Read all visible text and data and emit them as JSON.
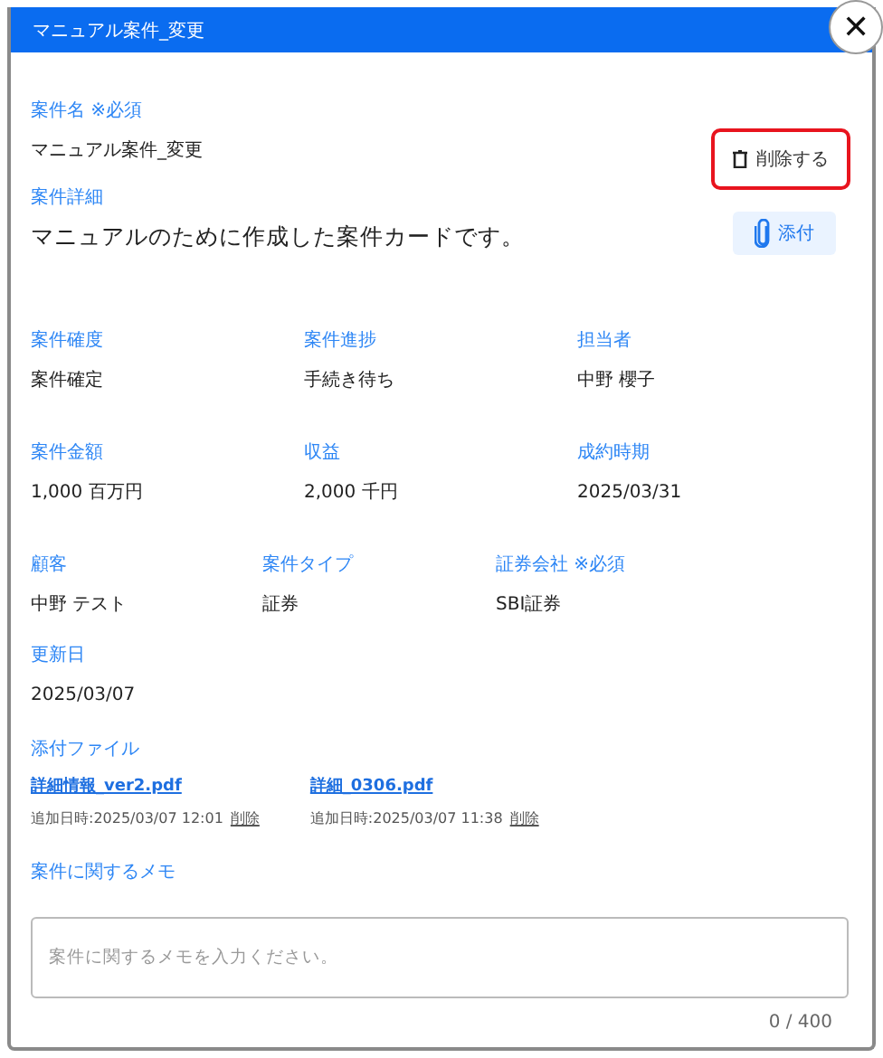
{
  "window": {
    "title": "マニュアル案件_変更",
    "close": "✕"
  },
  "actions": {
    "delete": {
      "label": "削除する",
      "highlighted": true
    },
    "attach": {
      "label": "添付"
    }
  },
  "name": {
    "label": "案件名 ※必須",
    "value": "マニュアル案件_変更"
  },
  "detail": {
    "label": "案件詳細",
    "value": "マニュアルのために作成した案件カードです。"
  },
  "field_rows": [
    {
      "kind": "wide",
      "fields": [
        {
          "label": "案件確度",
          "value": "案件確定"
        },
        {
          "label": "案件進捗",
          "value": "手続き待ち"
        },
        {
          "label": "担当者",
          "value": "中野 櫻子"
        }
      ]
    },
    {
      "kind": "wide",
      "fields": [
        {
          "label": "案件金額",
          "value": "1,000 百万円"
        },
        {
          "label": "収益",
          "value": "2,000 千円"
        },
        {
          "label": "成約時期",
          "value": "2025/03/31"
        }
      ]
    },
    {
      "kind": "compact",
      "fields": [
        {
          "label": "顧客",
          "value": "中野 テスト"
        },
        {
          "label": "案件タイプ",
          "value": "証券"
        },
        {
          "label": "証券会社 ※必須",
          "value": "SBI証券"
        }
      ]
    },
    {
      "kind": "compact",
      "fields": [
        {
          "label": "更新日",
          "value": "2025/03/07"
        }
      ]
    }
  ],
  "attachments": {
    "label": "添付ファイル",
    "files": [
      {
        "name": "詳細情報_ver2.pdf",
        "added": "追加日時:2025/03/07 12:01",
        "delete": "削除"
      },
      {
        "name": "詳細_0306.pdf",
        "added": "追加日時:2025/03/07 11:38",
        "delete": "削除"
      }
    ]
  },
  "memo": {
    "label": "案件に関するメモ",
    "placeholder": "案件に関するメモを入力ください。",
    "count": "0 / 400"
  }
}
